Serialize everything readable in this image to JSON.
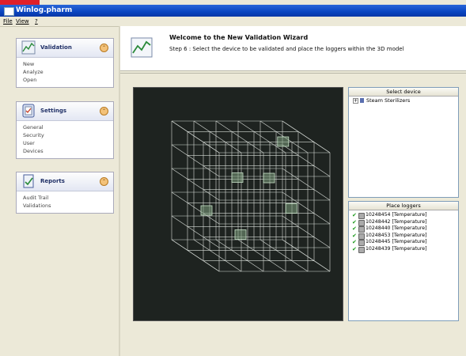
{
  "window": {
    "title": "Winlog.pharm"
  },
  "menu": [
    "File",
    "View",
    "?"
  ],
  "sidebar": {
    "panels": [
      {
        "title": "Validation",
        "icon": "chart-icon",
        "items": [
          "New",
          "Analyze",
          "Open"
        ]
      },
      {
        "title": "Settings",
        "icon": "settings-icon",
        "items": [
          "General",
          "Security",
          "User",
          "Devices"
        ]
      },
      {
        "title": "Reports",
        "icon": "report-icon",
        "items": [
          "Audit Trail",
          "Validations"
        ]
      }
    ]
  },
  "wizard": {
    "title": "Welcome to the New Validation Wizard",
    "step": "Step 6 : Select the device to be validated and place the loggers within the 3D model"
  },
  "device_panel": {
    "header": "Select device",
    "items": [
      {
        "expander": "+",
        "label": "Steam Sterilizers"
      }
    ]
  },
  "loggers_panel": {
    "header": "Place loggers",
    "items": [
      "10248454 [Temperature]",
      "10248442 [Temperature]",
      "10248440 [Temperature]",
      "10248453 [Temperature]",
      "10248445 [Temperature]",
      "10248439 [Temperature]"
    ]
  },
  "colors": {
    "titlebar": "#0a45c0",
    "viewport_bg": "#1e2320",
    "check": "#1c9a1c",
    "brand_strip": "#e0202a"
  }
}
